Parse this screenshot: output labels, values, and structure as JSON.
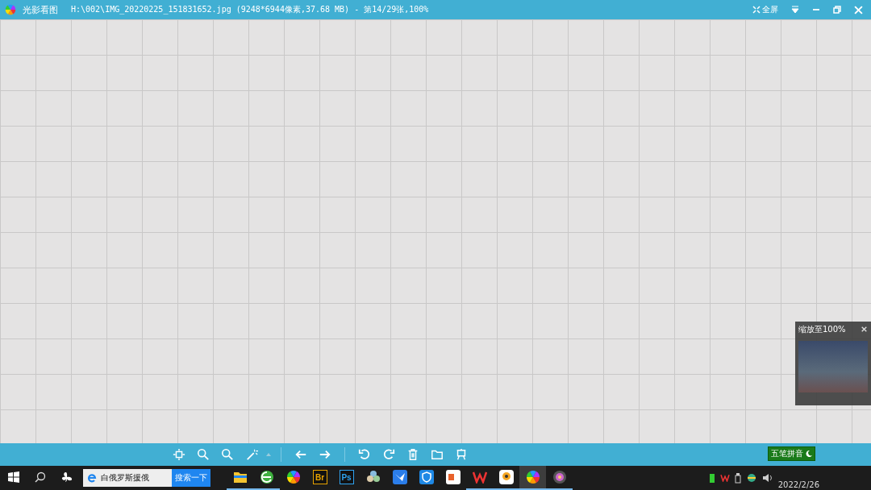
{
  "window": {
    "app_name": "光影看图",
    "title": "H:\\002\\IMG_20220225_151831652.jpg (9248*6944像素,37.68 MB) - 第14/29张,100%",
    "fullscreen_label": "全屏"
  },
  "navigator": {
    "title": "缩放至100%"
  },
  "taskbar": {
    "search_text": "白俄罗斯援俄",
    "search_button": "搜索一下",
    "apps": [
      {
        "kind": "folder",
        "open": true,
        "selected": false
      },
      {
        "kind": "browser",
        "open": true,
        "selected": false
      },
      {
        "kind": "wheel",
        "open": false,
        "selected": false
      },
      {
        "kind": "badge",
        "label": "Br",
        "color": "#e8a400",
        "open": false,
        "selected": false
      },
      {
        "kind": "badge",
        "label": "Ps",
        "color": "#2fa3f0",
        "open": false,
        "selected": false
      },
      {
        "kind": "flower",
        "open": false,
        "selected": false
      },
      {
        "kind": "bird",
        "open": false,
        "selected": false
      },
      {
        "kind": "shield",
        "open": false,
        "selected": false
      },
      {
        "kind": "office",
        "open": false,
        "selected": false
      },
      {
        "kind": "wps",
        "open": true,
        "selected": false
      },
      {
        "kind": "camera",
        "open": true,
        "selected": false
      },
      {
        "kind": "wheel",
        "open": true,
        "selected": true
      },
      {
        "kind": "lens",
        "open": true,
        "selected": false
      }
    ]
  },
  "ime": {
    "label": "五笔拼音"
  },
  "clock": {
    "date": "2022/2/26"
  }
}
